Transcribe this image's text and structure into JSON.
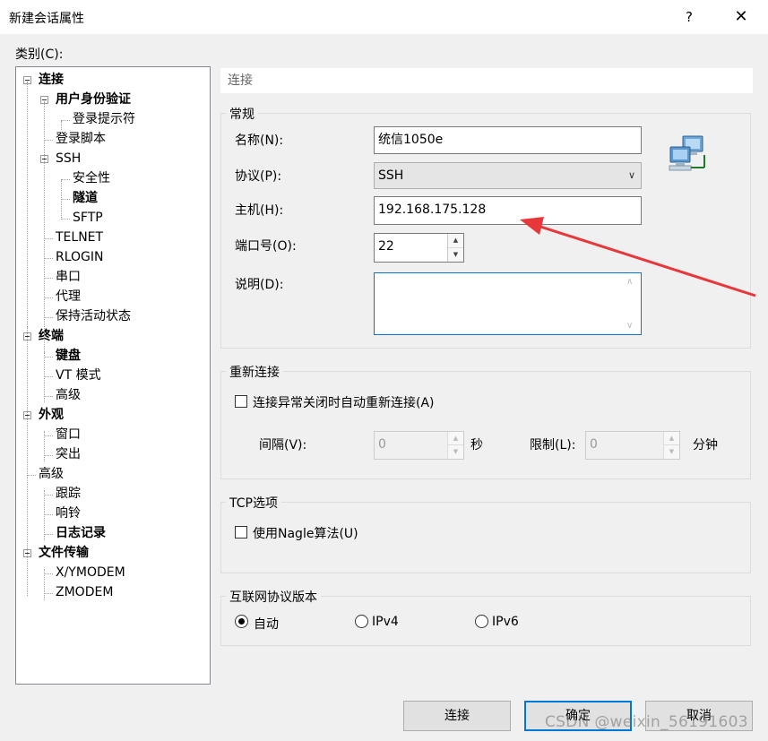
{
  "window": {
    "title": "新建会话属性",
    "help_label": "?",
    "close_label": "✕"
  },
  "category_label": "类别(C):",
  "tree": [
    {
      "label": "连接",
      "bold": true
    },
    {
      "label": "用户身份验证",
      "bold": true
    },
    {
      "label": "登录提示符",
      "bold": false
    },
    {
      "label": "登录脚本",
      "bold": false
    },
    {
      "label": "SSH",
      "bold": false
    },
    {
      "label": "安全性",
      "bold": false
    },
    {
      "label": "隧道",
      "bold": true
    },
    {
      "label": "SFTP",
      "bold": false
    },
    {
      "label": "TELNET",
      "bold": false
    },
    {
      "label": "RLOGIN",
      "bold": false
    },
    {
      "label": "串口",
      "bold": false
    },
    {
      "label": "代理",
      "bold": false
    },
    {
      "label": "保持活动状态",
      "bold": false
    },
    {
      "label": "终端",
      "bold": true
    },
    {
      "label": "键盘",
      "bold": true
    },
    {
      "label": "VT 模式",
      "bold": false
    },
    {
      "label": "高级",
      "bold": false
    },
    {
      "label": "外观",
      "bold": true
    },
    {
      "label": "窗口",
      "bold": false
    },
    {
      "label": "突出",
      "bold": false
    },
    {
      "label": "高级",
      "bold": false
    },
    {
      "label": "跟踪",
      "bold": false
    },
    {
      "label": "响铃",
      "bold": false
    },
    {
      "label": "日志记录",
      "bold": true
    },
    {
      "label": "文件传输",
      "bold": true
    },
    {
      "label": "X/YMODEM",
      "bold": false
    },
    {
      "label": "ZMODEM",
      "bold": false
    }
  ],
  "panel": {
    "header": "连接",
    "general": {
      "title": "常规",
      "name_label": "名称(N):",
      "name_value": "统信1050e",
      "protocol_label": "协议(P):",
      "protocol_value": "SSH",
      "host_label": "主机(H):",
      "host_value": "192.168.175.128",
      "port_label": "端口号(O):",
      "port_value": "22",
      "desc_label": "说明(D):",
      "desc_value": ""
    },
    "reconnect": {
      "title": "重新连接",
      "auto_label": "连接异常关闭时自动重新连接(A)",
      "interval_label": "间隔(V):",
      "interval_value": "0",
      "interval_unit": "秒",
      "limit_label": "限制(L):",
      "limit_value": "0",
      "limit_unit": "分钟"
    },
    "tcp": {
      "title": "TCP选项",
      "nagle_label": "使用Nagle算法(U)"
    },
    "ipver": {
      "title": "互联网协议版本",
      "options": [
        "自动",
        "IPv4",
        "IPv6"
      ],
      "selected": "自动"
    }
  },
  "buttons": {
    "connect": "连接",
    "ok": "确定",
    "cancel": "取消"
  },
  "watermark": "CSDN @weixin_56191603",
  "colors": {
    "annotation_arrow": "#e8373a",
    "focus_border": "#0078d7"
  }
}
